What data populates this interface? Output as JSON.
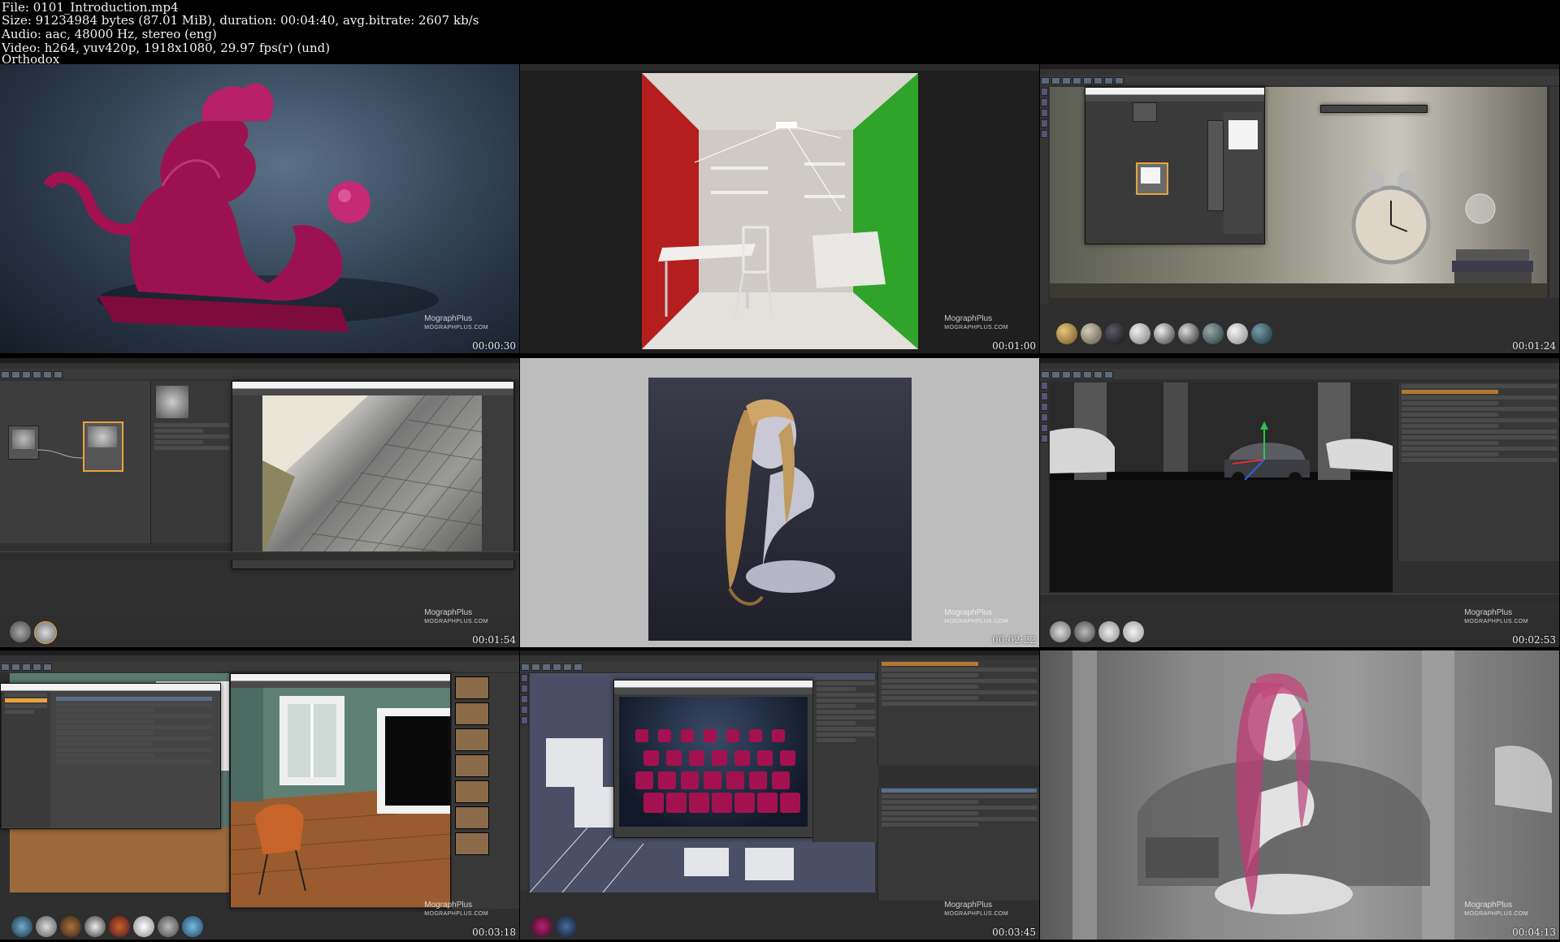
{
  "header": {
    "file_line": "File: 0101_Introduction.mp4",
    "size_line": "Size: 91234984 bytes (87.01 MiB), duration: 00:04:40, avg.bitrate: 2607 kb/s",
    "audio_line": "Audio: aac, 48000 Hz, stereo (eng)",
    "video_line": "Video: h264, yuv420p, 1918x1080, 29.97 fps(r) (und)",
    "source_line": "Orthodox"
  },
  "watermark": {
    "brand_top": "MographPlus",
    "brand_url": "MOGRAPHPLUS.COM"
  },
  "thumbnails": [
    {
      "timestamp": "00:00:30",
      "scene": "red-jade-dragon-sculpture"
    },
    {
      "timestamp": "00:01:00",
      "scene": "cornell-room-with-desk-and-chair"
    },
    {
      "timestamp": "00:01:24",
      "scene": "alarm-clock-material-editor"
    },
    {
      "timestamp": "00:01:54",
      "scene": "cobblestone-wall-displacement"
    },
    {
      "timestamp": "00:02:22",
      "scene": "hair-on-bust-render"
    },
    {
      "timestamp": "00:02:53",
      "scene": "car-in-parking-garage-viewport"
    },
    {
      "timestamp": "00:03:18",
      "scene": "room-with-chair-render-settings"
    },
    {
      "timestamp": "00:03:45",
      "scene": "instanced-cubes-render"
    },
    {
      "timestamp": "00:04:13",
      "scene": "bust-and-car-overlay"
    }
  ],
  "colors": {
    "background": "#000000",
    "app_ui": "#333333",
    "selection_orange": "#e8a33c",
    "dragon": "#a3124f",
    "room_red": "#b51e1e",
    "room_green": "#2fa32a"
  }
}
